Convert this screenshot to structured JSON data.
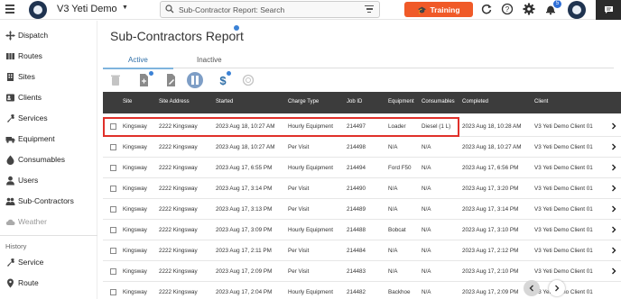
{
  "app": {
    "title": "V3 Yeti Demo"
  },
  "search": {
    "placeholder": "Sub-Contractor Report: Search"
  },
  "header": {
    "training_label": "Training",
    "notification_count": "5"
  },
  "sidebar": {
    "items": [
      {
        "label": "Dispatch",
        "icon": "dispatch-icon"
      },
      {
        "label": "Routes",
        "icon": "routes-icon"
      },
      {
        "label": "Sites",
        "icon": "sites-icon"
      },
      {
        "label": "Clients",
        "icon": "clients-icon"
      },
      {
        "label": "Services",
        "icon": "services-icon"
      },
      {
        "label": "Equipment",
        "icon": "equipment-icon"
      },
      {
        "label": "Consumables",
        "icon": "consumables-icon"
      },
      {
        "label": "Users",
        "icon": "users-icon"
      },
      {
        "label": "Sub-Contractors",
        "icon": "sub-contractors-icon"
      },
      {
        "label": "Weather",
        "icon": "weather-icon"
      }
    ],
    "history_label": "History",
    "history_items": [
      {
        "label": "Service",
        "icon": "service-history-icon"
      },
      {
        "label": "Route",
        "icon": "route-history-icon"
      }
    ]
  },
  "page": {
    "title": "Sub-Contractors Report",
    "tabs": [
      {
        "label": "Active"
      },
      {
        "label": "Inactive"
      }
    ]
  },
  "table": {
    "columns": [
      "Site",
      "Site Address",
      "Started",
      "Charge Type",
      "Job ID",
      "Equipment",
      "Consumables",
      "Completed",
      "Client"
    ],
    "rows": [
      [
        "Kingsway",
        "2222 Kingsway",
        "2023 Aug 18, 10:27 AM",
        "Hourly Equipment",
        "214497",
        "Loader",
        "Diesel (1 L)",
        "2023 Aug 18, 10:28 AM",
        "V3 Yeti Demo Client 01"
      ],
      [
        "Kingsway",
        "2222 Kingsway",
        "2023 Aug 18, 10:27 AM",
        "Per Visit",
        "214498",
        "N/A",
        "N/A",
        "2023 Aug 18, 10:27 AM",
        "V3 Yeti Demo Client 01"
      ],
      [
        "Kingsway",
        "2222 Kingsway",
        "2023 Aug 17, 6:55 PM",
        "Hourly Equipment",
        "214494",
        "Ford F50",
        "N/A",
        "2023 Aug 17, 6:56 PM",
        "V3 Yeti Demo Client 01"
      ],
      [
        "Kingsway",
        "2222 Kingsway",
        "2023 Aug 17, 3:14 PM",
        "Per Visit",
        "214490",
        "N/A",
        "N/A",
        "2023 Aug 17, 3:20 PM",
        "V3 Yeti Demo Client 01"
      ],
      [
        "Kingsway",
        "2222 Kingsway",
        "2023 Aug 17, 3:13 PM",
        "Per Visit",
        "214489",
        "N/A",
        "N/A",
        "2023 Aug 17, 3:14 PM",
        "V3 Yeti Demo Client 01"
      ],
      [
        "Kingsway",
        "2222 Kingsway",
        "2023 Aug 17, 3:09 PM",
        "Hourly Equipment",
        "214488",
        "Bobcat",
        "N/A",
        "2023 Aug 17, 3:10 PM",
        "V3 Yeti Demo Client 01"
      ],
      [
        "Kingsway",
        "2222 Kingsway",
        "2023 Aug 17, 2:11 PM",
        "Per Visit",
        "214484",
        "N/A",
        "N/A",
        "2023 Aug 17, 2:12 PM",
        "V3 Yeti Demo Client 01"
      ],
      [
        "Kingsway",
        "2222 Kingsway",
        "2023 Aug 17, 2:09 PM",
        "Per Visit",
        "214483",
        "N/A",
        "N/A",
        "2023 Aug 17, 2:10 PM",
        "V3 Yeti Demo Client 01"
      ],
      [
        "Kingsway",
        "2222 Kingsway",
        "2023 Aug 17, 2:04 PM",
        "Hourly Equipment",
        "214482",
        "Backhoe",
        "N/A",
        "2023 Aug 17, 2:09 PM",
        "V3 Yeti Demo Client 01"
      ]
    ]
  },
  "colors": {
    "accent": "#f05a28",
    "highlight": "#e0302a",
    "header_bg": "#3c3c3c",
    "link_blue": "#2f6fa8"
  }
}
